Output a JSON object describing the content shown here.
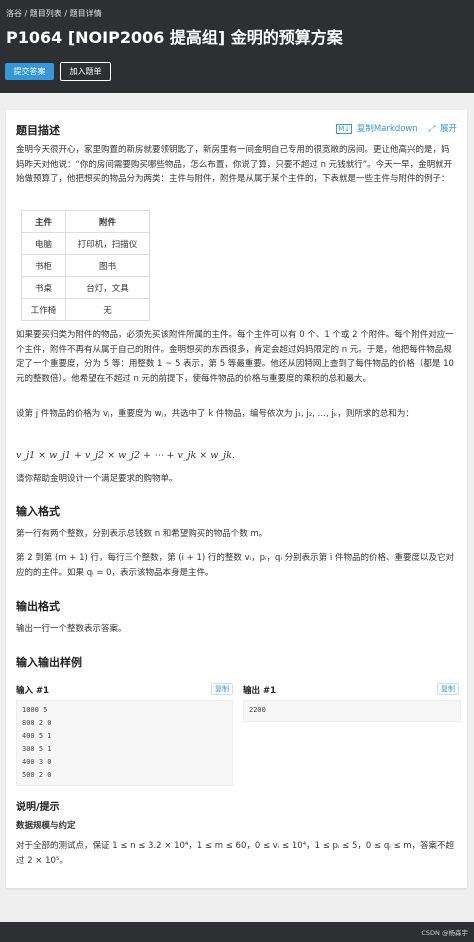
{
  "breadcrumb": [
    "洛谷",
    "/",
    "题目列表",
    "/",
    "题目详情"
  ],
  "page_title": "P1064 [NOIP2006 提高组] 金明的预算方案",
  "buttons": {
    "submit": "提交答案",
    "add": "加入题单"
  },
  "tools": {
    "copy_markdown": "复制Markdown",
    "expand": "展开"
  },
  "sections": {
    "desc": "题目描述",
    "input": "输入格式",
    "output": "输出格式",
    "samples": "输入输出样例",
    "hint": "说明/提示",
    "scale": "数据规模与约定"
  },
  "desc": {
    "p1": "金明今天很开心，家里购置的新房就要领钥匙了，新房里有一间金明自己专用的很宽敞的房间。更让他高兴的是，妈妈昨天对他说：“你的房间需要购买哪些物品，怎么布置，你说了算，只要不超过 n 元钱就行”。今天一早，金明就开始做预算了，他把想买的物品分为两类：主件与附件，附件是从属于某个主件的，下表就是一些主件与附件的例子：",
    "table_header": [
      "主件",
      "附件"
    ],
    "table_rows": [
      [
        "电脑",
        "打印机，扫描仪"
      ],
      [
        "书柜",
        "图书"
      ],
      [
        "书桌",
        "台灯，文具"
      ],
      [
        "工作椅",
        "无"
      ]
    ],
    "p2": "如果要买归类为附件的物品，必须先买该附件所属的主件。每个主件可以有 0 个、1 个或 2 个附件。每个附件对应一个主件，附件不再有从属于自己的附件。金明想买的东西很多，肯定会超过妈妈限定的 n 元。于是，他把每件物品规定了一个重要度，分为 5 等：用整数 1 ~ 5 表示，第 5 等最重要。他还从因特网上查到了每件物品的价格（都是 10 元的整数倍）。他希望在不超过 n 元的前提下，使每件物品的价格与重要度的乘积的总和最大。",
    "p3": "设第 j 件物品的价格为 vⱼ，重要度为 wⱼ，共选中了 k 件物品，编号依次为 j₁, j₂, …, jₖ，则所求的总和为：",
    "formula": "v_j1 × w_j1 + v_j2 × w_j2 + ⋯ + v_jk × w_jk.",
    "p4": "请你帮助金明设计一个满足要求的购物单。"
  },
  "input": {
    "p1": "第一行有两个整数，分别表示总钱数 n 和希望购买的物品个数 m。",
    "p2": "第 2 到第 (m + 1) 行，每行三个整数，第 (i + 1) 行的整数 vᵢ，pᵢ，qᵢ 分别表示第 i 件物品的价格、重要度以及它对应的的主件。如果 qᵢ = 0，表示该物品本身是主件。"
  },
  "output": {
    "p1": "输出一行一个整数表示答案。"
  },
  "samples": {
    "input_label": "输入 #1",
    "output_label": "输出 #1",
    "copy": "复制",
    "input_data": "1000 5\n800 2 0\n400 5 1\n300 5 1\n400 3 0\n500 2 0",
    "output_data": "2200"
  },
  "hint": {
    "p1": "对于全部的测试点，保证 1 ≤ n ≤ 3.2 × 10⁴，1 ≤ m ≤ 60，0 ≤ vᵢ ≤ 10⁴，1 ≤ pᵢ ≤ 5，0 ≤ qᵢ ≤ m，答案不超过 2 × 10⁵。"
  },
  "watermark": "CSDN @杨森宇",
  "colors": {
    "header_bg": "#2d2f33",
    "accent": "#3498db",
    "page_bg": "#efefef"
  }
}
